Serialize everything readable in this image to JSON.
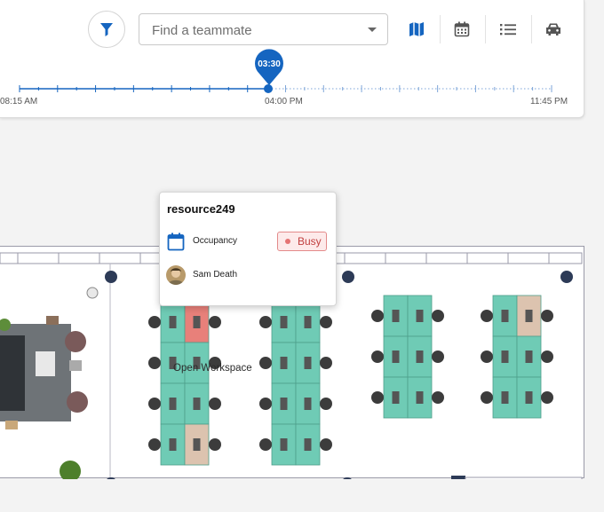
{
  "toolbar": {
    "search_placeholder": "Find a teammate"
  },
  "timeline": {
    "start_label": "08:15 AM",
    "mid_label": "04:00 PM",
    "end_label": "11:45 PM",
    "current_time": "03:30",
    "accent_color": "#1565c0"
  },
  "view_icons": [
    "map-icon",
    "calendar-icon",
    "list-icon",
    "car-icon"
  ],
  "popup": {
    "title": "resource249",
    "occupancy_label": "Occupancy",
    "status": "Busy",
    "person_name": "Sam Death"
  },
  "floor": {
    "zone_label": "Open Workspace",
    "desk_color": "#6fcbb5",
    "busy_desk_color": "#e8807a",
    "unavailable_desk_color": "#dcc3af"
  }
}
